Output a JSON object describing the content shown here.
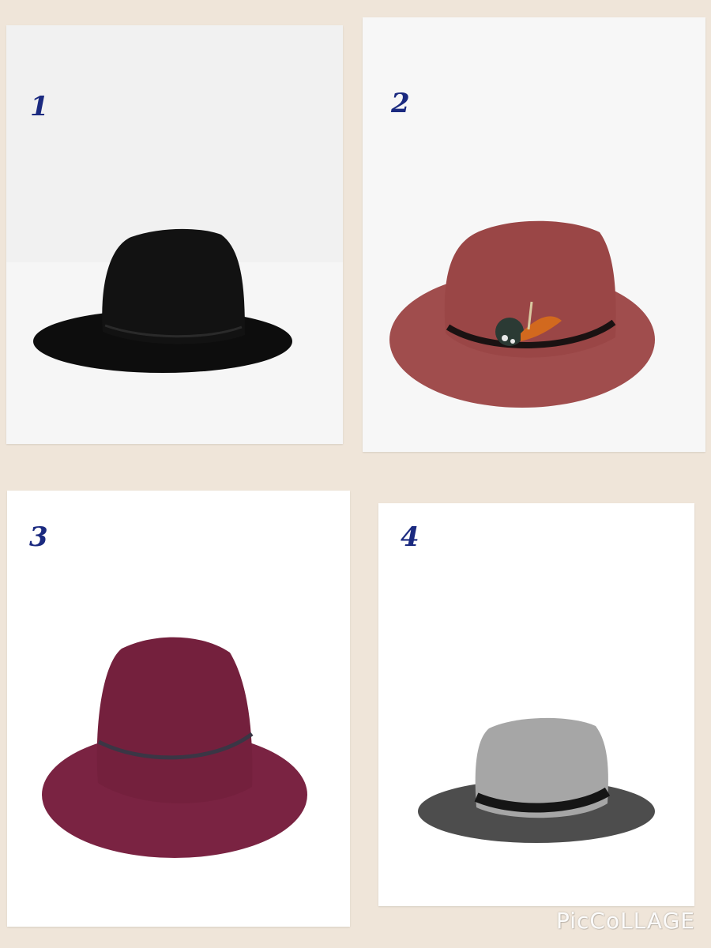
{
  "panels": [
    {
      "number": "1",
      "hat": "black-fedora-hat"
    },
    {
      "number": "2",
      "hat": "rust-feather-fedora-hat"
    },
    {
      "number": "3",
      "hat": "burgundy-fedora-hat"
    },
    {
      "number": "4",
      "hat": "grey-two-tone-fedora-hat"
    }
  ],
  "colors": {
    "background": "#efe5d9",
    "number": "#1b2a80"
  },
  "watermark": "PicCoLLAGE"
}
